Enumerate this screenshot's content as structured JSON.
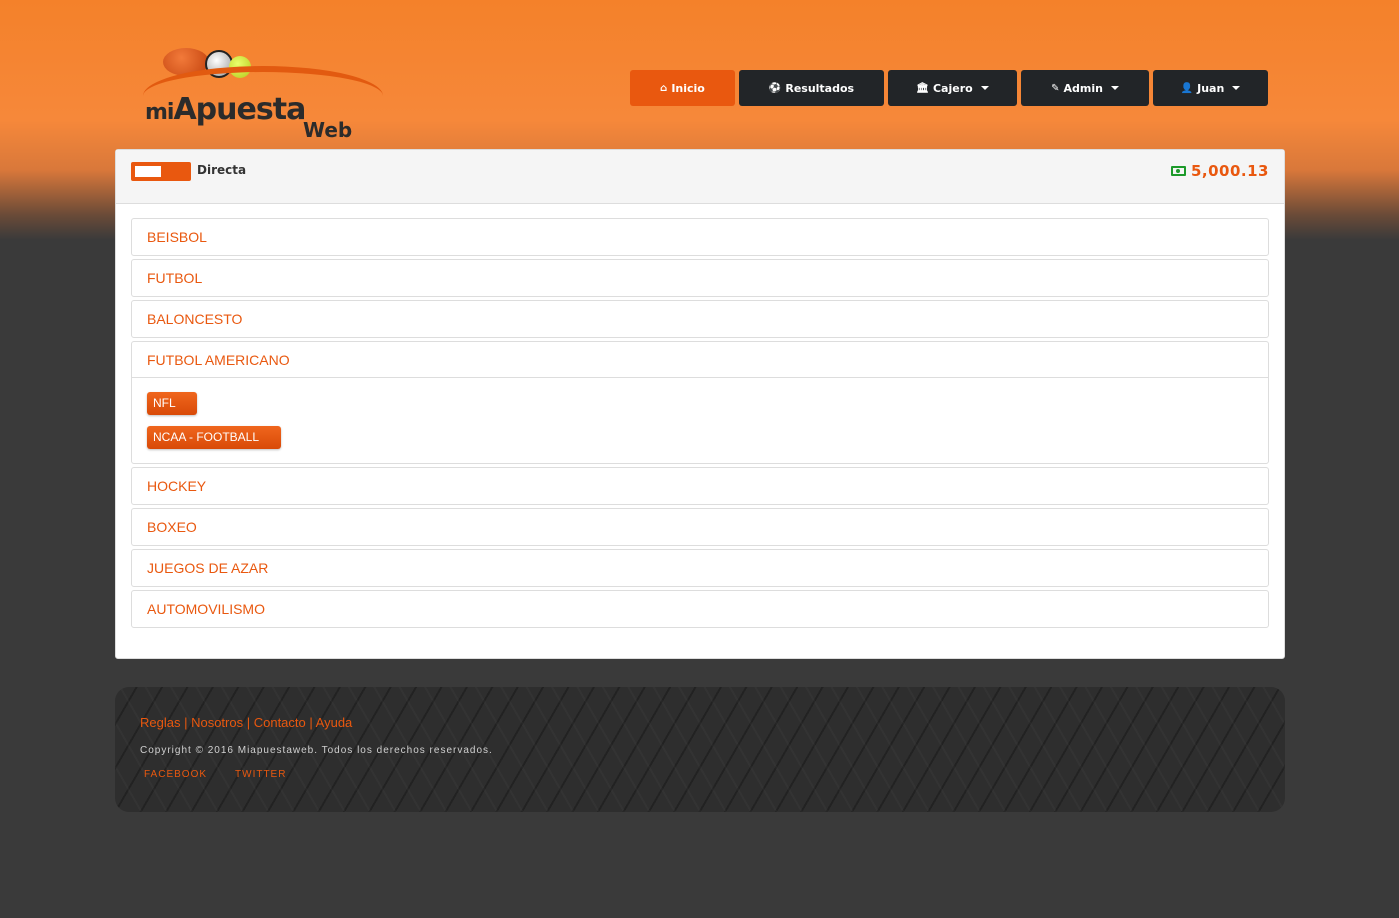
{
  "logo": {
    "line1_prefix": "mi",
    "line1": "Apuesta",
    "line2": "Web"
  },
  "nav": {
    "items": [
      {
        "label": "Inicio",
        "icon": "home-icon",
        "active": true
      },
      {
        "label": "Resultados",
        "icon": "soccer-ball-icon"
      },
      {
        "label": "Cajero",
        "icon": "bank-icon",
        "dropdown": true
      },
      {
        "label": "Admin",
        "icon": "wrench-icon",
        "dropdown": true
      },
      {
        "label": "Juan",
        "icon": "user-icon",
        "dropdown": true
      }
    ],
    "icons": {
      "home": "⌂",
      "ball": "⚽",
      "bank": "🏛",
      "wrench": "✎",
      "user": "👤"
    }
  },
  "panel": {
    "mode_label": "Directa",
    "balance": "5,000.13"
  },
  "sports": [
    {
      "name": "BEISBOL"
    },
    {
      "name": "FUTBOL"
    },
    {
      "name": "BALONCESTO"
    },
    {
      "name": "FUTBOL AMERICANO",
      "leagues": [
        "NFL",
        "NCAA - FOOTBALL"
      ]
    },
    {
      "name": "HOCKEY"
    },
    {
      "name": "BOXEO"
    },
    {
      "name": "JUEGOS DE AZAR"
    },
    {
      "name": "AUTOMOVILISMO"
    }
  ],
  "footer": {
    "links": [
      "Reglas",
      "Nosotros",
      "Contacto",
      "Ayuda"
    ],
    "separator": " | ",
    "copyright": "Copyright © 2016 Miapuestaweb. Todos los derechos reservados.",
    "social": [
      "FACEBOOK",
      "TWITTER"
    ]
  },
  "colors": {
    "accent": "#e9580f",
    "nav_dark": "#222528",
    "money": "#1c9a2a"
  }
}
